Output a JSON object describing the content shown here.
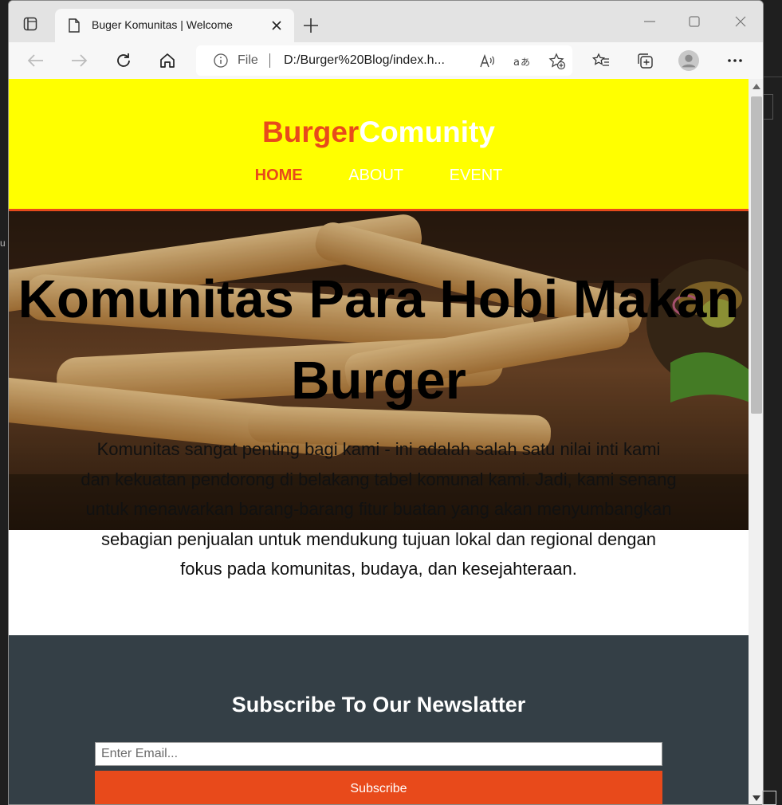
{
  "browser": {
    "tab_title": "Buger Komunitas | Welcome",
    "address_scheme": "File",
    "address_url": "D:/Burger%20Blog/index.h...",
    "icons": [
      "tab-actions-icon",
      "page-icon",
      "close-icon",
      "plus-icon",
      "minimize-icon",
      "maximize-icon",
      "close-window-icon",
      "back-icon",
      "forward-icon",
      "refresh-icon",
      "home-icon",
      "info-icon",
      "read-aloud-icon",
      "translate-icon",
      "add-favorite-icon",
      "favorites-icon",
      "collections-icon",
      "profile-icon",
      "more-icon"
    ]
  },
  "site": {
    "logo_part1": "Burger",
    "logo_part2": "Comunity",
    "nav": [
      {
        "label": "HOME",
        "active": true
      },
      {
        "label": "ABOUT",
        "active": false
      },
      {
        "label": "EVENT",
        "active": false
      }
    ],
    "hero_title": "Komunitas Para Hobi Makan Burger",
    "hero_text": "Komunitas sangat penting bagi kami - ini adalah salah satu nilai inti kami dan kekuatan pendorong di belakang tabel komunal kami. Jadi, kami senang untuk menawarkan barang-barang fitur buatan yang akan menyumbangkan sebagian penjualan untuk mendukung tujuan lokal dan regional dengan fokus pada komunitas, budaya, dan kesejahteraan.",
    "newsletter": {
      "title": "Subscribe To Our Newslatter",
      "email_placeholder": "Enter Email...",
      "button_label": "Subscribe"
    }
  },
  "colors": {
    "header_bg": "#ffff00",
    "accent": "#e84a1b",
    "newsletter_bg": "#343f46"
  },
  "outside_fragment": "u"
}
